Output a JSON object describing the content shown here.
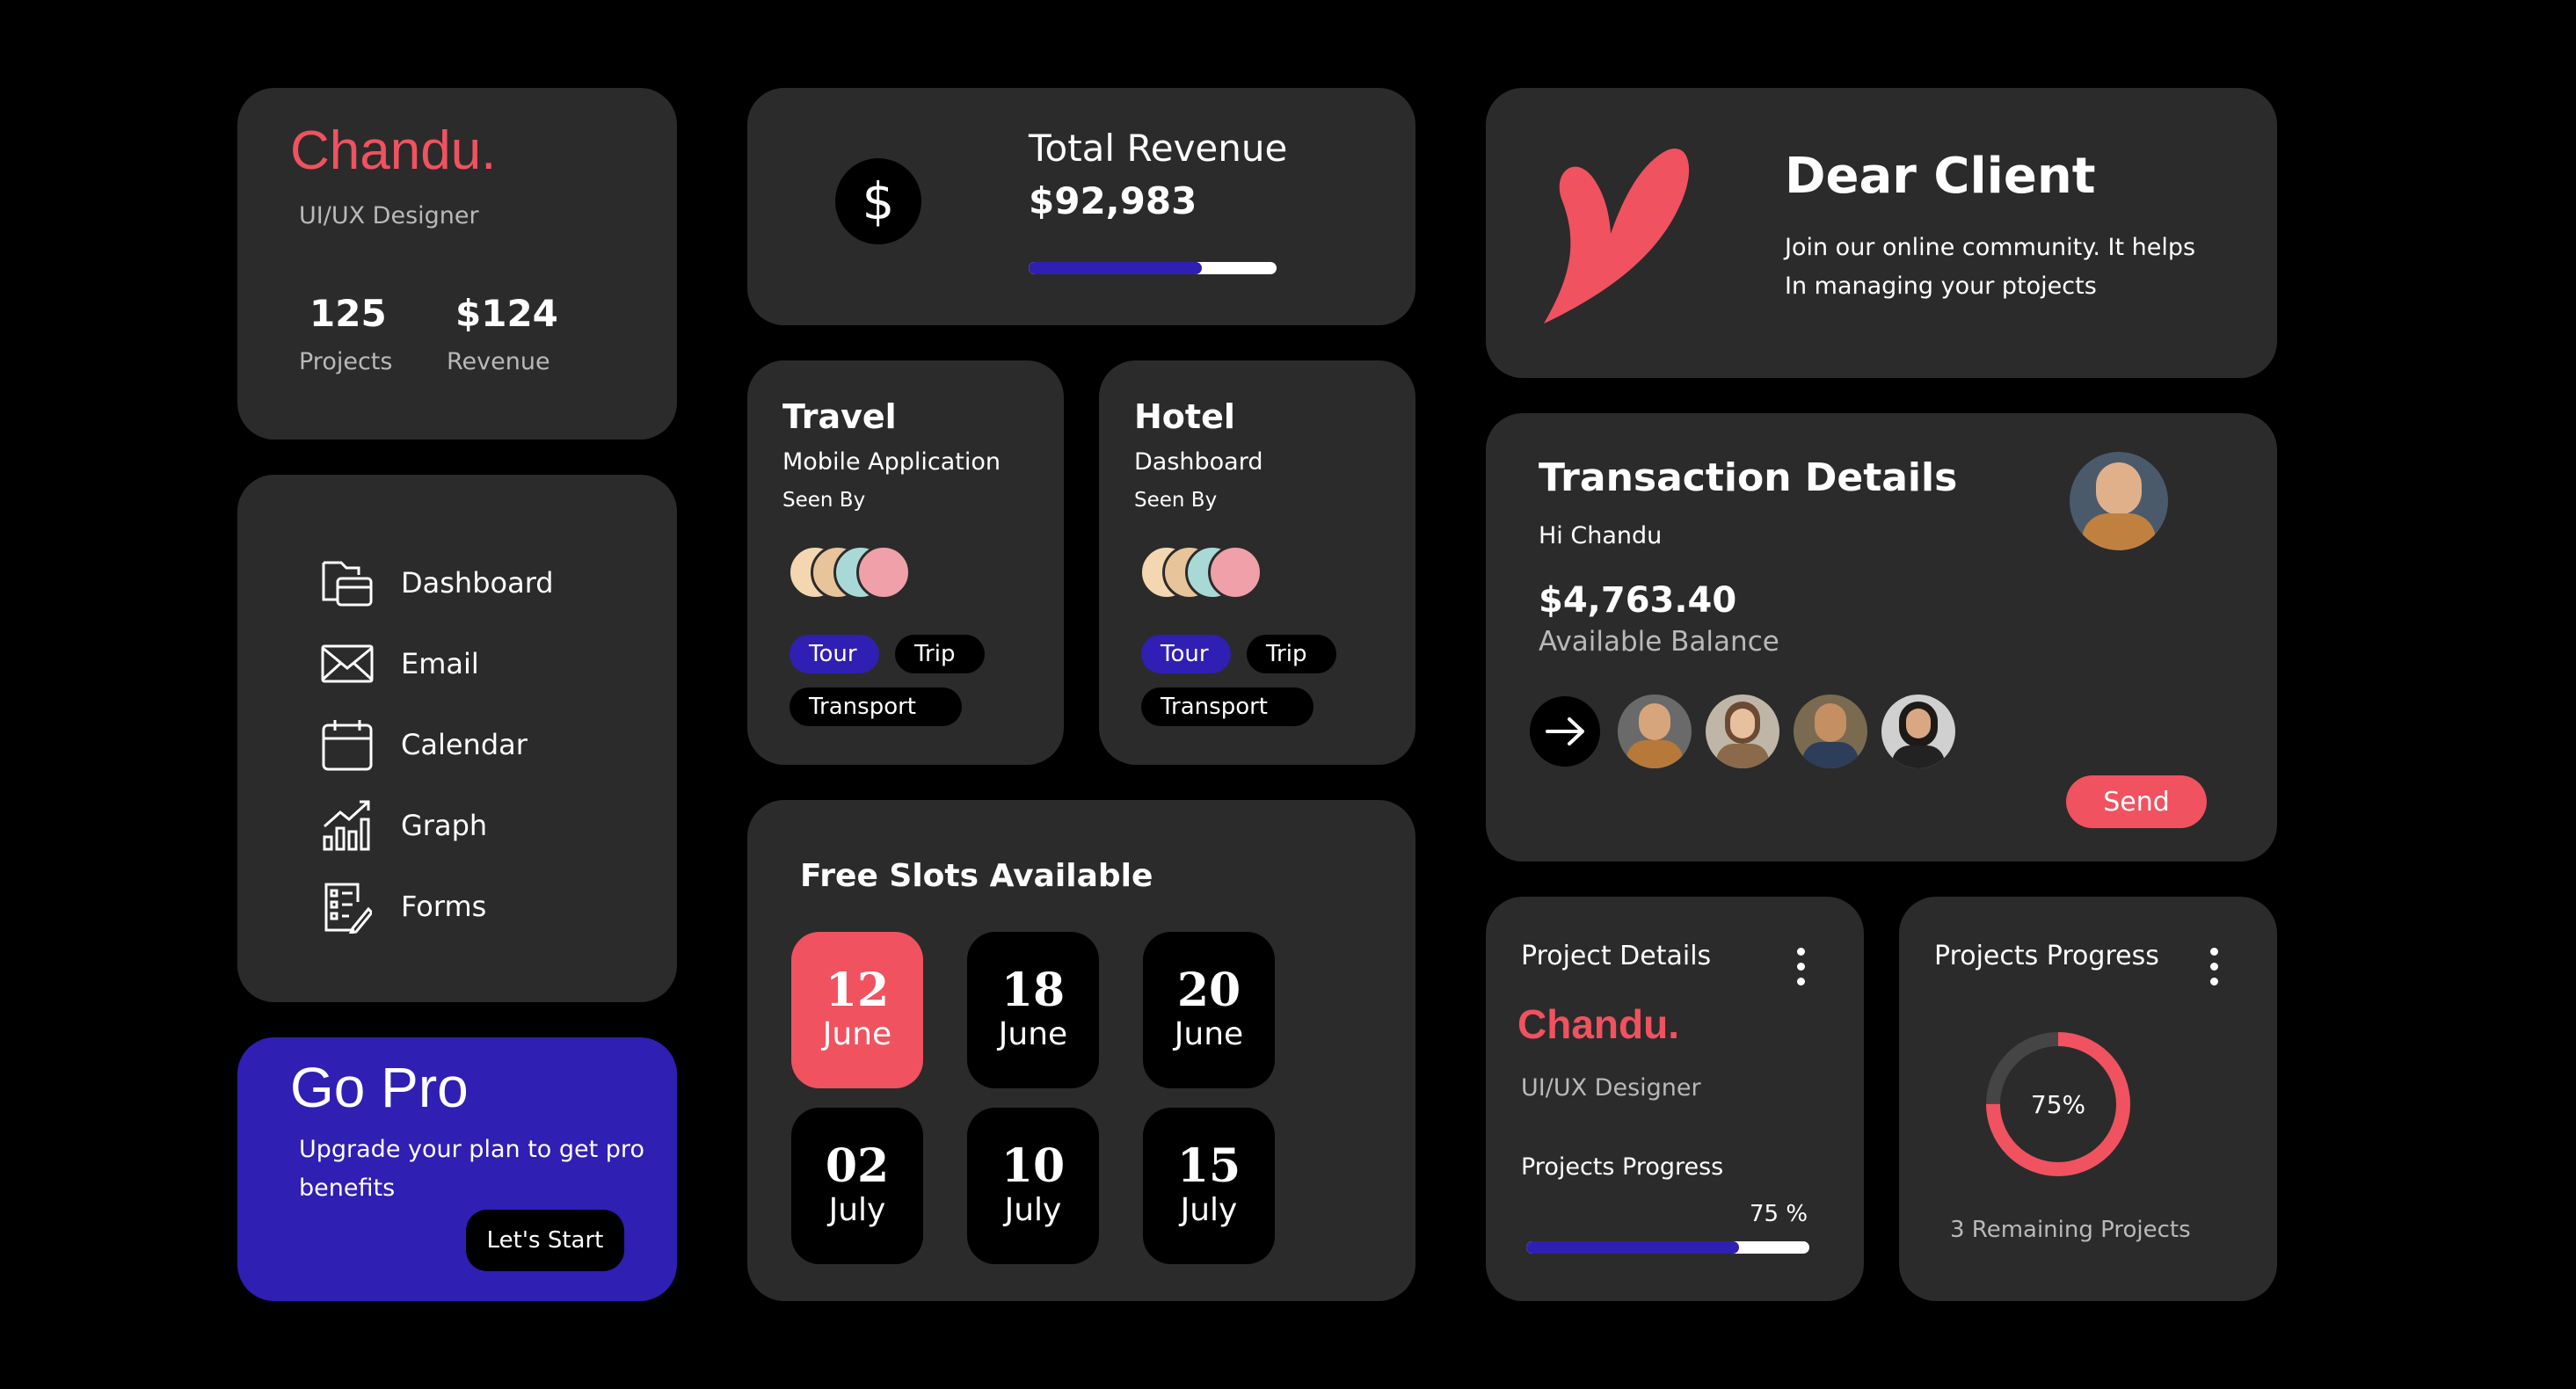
{
  "colors": {
    "accent": "#f0525f",
    "brand_blue": "#2f1fb3",
    "card": "#2b2b2b",
    "background": "#000000"
  },
  "profile": {
    "name": "Chandu.",
    "role": "UI/UX Designer",
    "projects_value": "125",
    "projects_label": "Projects",
    "revenue_value": "$124",
    "revenue_label": "Revenue"
  },
  "nav": {
    "items": [
      {
        "label": "Dashboard",
        "icon": "folder-icon"
      },
      {
        "label": "Email",
        "icon": "mail-icon"
      },
      {
        "label": "Calendar",
        "icon": "calendar-icon"
      },
      {
        "label": "Graph",
        "icon": "graph-icon"
      },
      {
        "label": "Forms",
        "icon": "form-icon"
      }
    ]
  },
  "gopro": {
    "title": "Go Pro",
    "text_line1": "Upgrade your plan to get pro",
    "text_line2": "benefits",
    "button": "Let's Start"
  },
  "revenue": {
    "title": "Total Revenue",
    "value": "$92,983",
    "icon": "dollar-icon",
    "progress": 0.7
  },
  "travel": {
    "title": "Travel",
    "subtitle": "Mobile Application",
    "seen_by": "Seen By",
    "tags": [
      "Tour",
      "Trip",
      "Transport"
    ]
  },
  "hotel": {
    "title": "Hotel",
    "subtitle": "Dashboard",
    "seen_by": "Seen By",
    "tags": [
      "Tour",
      "Trip",
      "Transport"
    ]
  },
  "slots": {
    "title": "Free Slots Available",
    "items": [
      {
        "day": "12",
        "month": "June",
        "selected": true
      },
      {
        "day": "18",
        "month": "June",
        "selected": false
      },
      {
        "day": "20",
        "month": "June",
        "selected": false
      },
      {
        "day": "02",
        "month": "July",
        "selected": false
      },
      {
        "day": "10",
        "month": "July",
        "selected": false
      },
      {
        "day": "15",
        "month": "July",
        "selected": false
      }
    ]
  },
  "client": {
    "title": "Dear Client",
    "line1": "Join our online community. It helps",
    "line2": "In managing your ptojects",
    "icon": "heart-leaf-icon"
  },
  "transaction": {
    "title": "Transaction Details",
    "greeting": "Hi Chandu",
    "amount": "$4,763.40",
    "amount_label": "Available Balance",
    "send": "Send",
    "arrow_icon": "arrow-right-icon"
  },
  "project_details": {
    "title": "Project Details",
    "name": "Chandu.",
    "role": "UI/UX Designer",
    "progress_label": "Projects Progress",
    "percent_text": "75 %",
    "progress": 0.75
  },
  "projects_progress": {
    "title": "Projects Progress",
    "percent_text": "75%",
    "progress": 0.75,
    "remaining": "3 Remaining Projects"
  }
}
